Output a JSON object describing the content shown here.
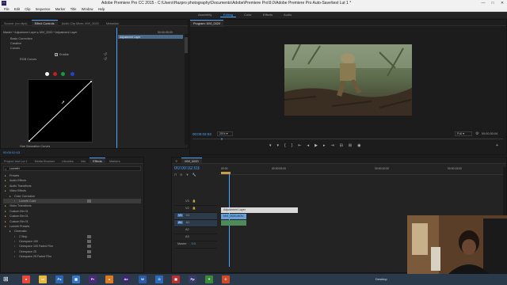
{
  "window": {
    "title": "Adobe Premiere Pro CC 2015 - C:\\Users\\Hazpro photography\\Documents\\Adobe\\Premiere Pro\\9.0\\Adobe Premiere Pro Auto-Save\\test Lut 1 *",
    "min": "—",
    "max": "□",
    "close": "✕"
  },
  "menu": [
    "File",
    "Edit",
    "Clip",
    "Sequence",
    "Marker",
    "Title",
    "Window",
    "Help"
  ],
  "workspaces": [
    "Assembly",
    "Editing",
    "Color",
    "Effects",
    "Audio"
  ],
  "workspace_active": "Editing",
  "source_tabs": [
    "Source: (no clips)",
    "Effect Controls",
    "Audio Clip Mixer: MVI_0020",
    "Metadata"
  ],
  "effect_controls": {
    "clip_path": "Master * Adjustment Layer  ▸  MVI_0020 * Adjustment Layer",
    "timecode": "00:00:05:00",
    "clip_bar": "Adjustment Layer",
    "rows": [
      "Basic Correction",
      "Creative",
      "Curves"
    ],
    "rgb_curves": "RGB Curves",
    "enable_label": "Enable",
    "hue_sat": "Hue Saturation Curves",
    "current_time": "00:00:02:03"
  },
  "program": {
    "tab": "Program: MVI_0020",
    "timecode": "00:00:02:03",
    "zoom": "25%",
    "quality": "Full",
    "duration": "00:00:30:04"
  },
  "project_tabs": [
    "Project: test Lut 1",
    "Media Browser",
    "Libraries",
    "Info",
    "Effects",
    "Markers"
  ],
  "search": {
    "value": "Lumetri"
  },
  "effects_tree": [
    {
      "level": 0,
      "label": "Presets"
    },
    {
      "level": 0,
      "label": "Audio Effects"
    },
    {
      "level": 0,
      "label": "Audio Transitions"
    },
    {
      "level": 0,
      "label": "Video Effects"
    },
    {
      "level": 1,
      "label": "Color Correction"
    },
    {
      "level": 2,
      "label": "Lumetri Color",
      "selected": true
    },
    {
      "level": 0,
      "label": "Video Transitions"
    },
    {
      "level": 0,
      "label": "Custom Bin 01"
    },
    {
      "level": 0,
      "label": "Custom Bin 01"
    },
    {
      "level": 0,
      "label": "Custom Bin 01"
    },
    {
      "level": 0,
      "label": "Lumetri Presets"
    },
    {
      "level": 1,
      "label": "Cinematic"
    },
    {
      "level": 2,
      "label": "2 Strip"
    },
    {
      "level": 2,
      "label": "Cinespace 100"
    },
    {
      "level": 2,
      "label": "Cinespace 100 Faded Film"
    },
    {
      "level": 2,
      "label": "Cinespace 25"
    },
    {
      "level": 2,
      "label": "Cinespace 25 Faded Film"
    }
  ],
  "timeline": {
    "tab": "MVI_0020",
    "timecode": "00:00:02:03",
    "ruler": [
      "00:00",
      "00:00:05:00",
      "00:00:10:00",
      "00:00:15:00"
    ],
    "video_tracks": [
      "V3",
      "V2",
      "V1"
    ],
    "audio_tracks": [
      "A1",
      "A2",
      "A3"
    ],
    "master": "Master",
    "master_val": "0.0",
    "clip_adjust": "Adjustment Layer",
    "clip_video": "MVI_0020.MOV"
  },
  "taskbar": {
    "apps": [
      {
        "name": "chrome",
        "color": "#e9493c",
        "glyph": "●"
      },
      {
        "name": "explorer",
        "color": "#e8b840",
        "glyph": "▭"
      },
      {
        "name": "photoshop",
        "color": "#2b66b3",
        "glyph": "Ps"
      },
      {
        "name": "app-blue",
        "color": "#3476c8",
        "glyph": "▦"
      },
      {
        "name": "premiere",
        "color": "#4a2a7a",
        "glyph": "Pr"
      },
      {
        "name": "vlc",
        "color": "#e07a1e",
        "glyph": "▲"
      },
      {
        "name": "aftereffects",
        "color": "#3b2a6b",
        "glyph": "Ae"
      },
      {
        "name": "word",
        "color": "#2a5aa8",
        "glyph": "W"
      },
      {
        "name": "outlook",
        "color": "#2d6ab8",
        "glyph": "O"
      },
      {
        "name": "app-red",
        "color": "#b83030",
        "glyph": "▣"
      },
      {
        "name": "app-pp",
        "color": "#3a3a6a",
        "glyph": "Pp"
      },
      {
        "name": "app-green",
        "color": "#3a8a3a",
        "glyph": "✦"
      },
      {
        "name": "app-c",
        "color": "#d04a2a",
        "glyph": "C"
      }
    ],
    "desktop": "Desktop"
  }
}
